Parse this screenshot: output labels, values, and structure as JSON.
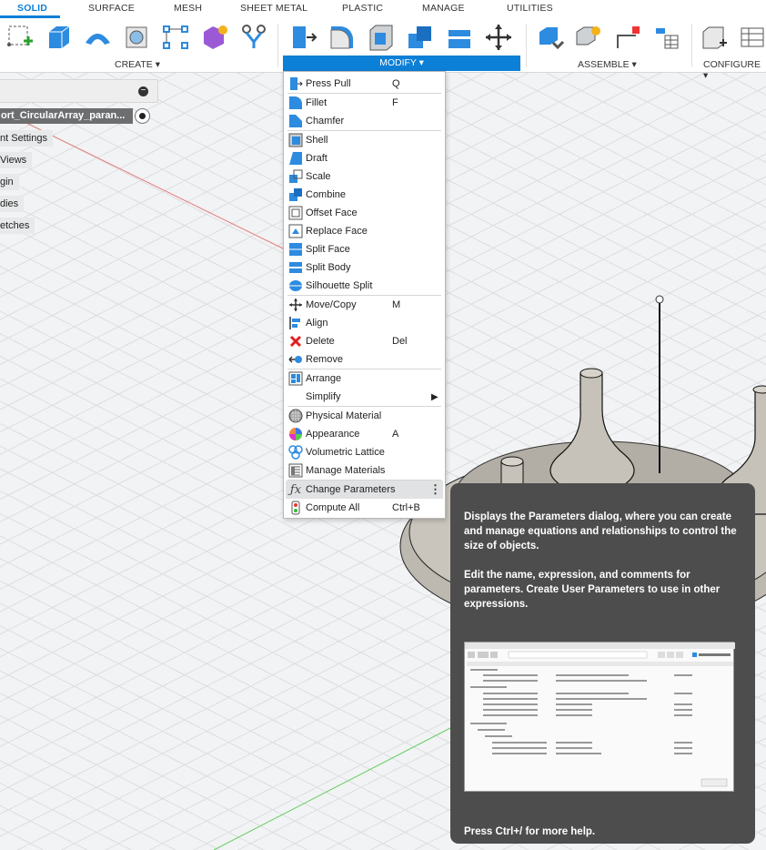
{
  "tabs": [
    "SOLID",
    "SURFACE",
    "MESH",
    "SHEET METAL",
    "PLASTIC",
    "MANAGE",
    "UTILITIES"
  ],
  "toolbar": {
    "create_label": "CREATE ▾",
    "modify_label": "MODIFY ▾",
    "assemble_label": "ASSEMBLE ▾",
    "configure_label": "CONFIGURE ▾"
  },
  "browser": {
    "minus": "−",
    "doc_name": "ort_CircularArray_paran...",
    "items": [
      "nt Settings",
      "Views",
      "gin",
      "dies",
      "etches"
    ]
  },
  "menu": {
    "items": [
      {
        "label": "Press Pull",
        "shortcut": "Q",
        "icon": "press-pull-icon"
      },
      {
        "label": "Fillet",
        "shortcut": "F",
        "icon": "fillet-icon"
      },
      {
        "label": "Chamfer",
        "shortcut": "",
        "icon": "chamfer-icon"
      },
      {
        "label": "Shell",
        "shortcut": "",
        "icon": "shell-icon"
      },
      {
        "label": "Draft",
        "shortcut": "",
        "icon": "draft-icon"
      },
      {
        "label": "Scale",
        "shortcut": "",
        "icon": "scale-icon"
      },
      {
        "label": "Combine",
        "shortcut": "",
        "icon": "combine-icon"
      },
      {
        "label": "Offset Face",
        "shortcut": "",
        "icon": "offset-face-icon"
      },
      {
        "label": "Replace Face",
        "shortcut": "",
        "icon": "replace-face-icon"
      },
      {
        "label": "Split Face",
        "shortcut": "",
        "icon": "split-face-icon"
      },
      {
        "label": "Split Body",
        "shortcut": "",
        "icon": "split-body-icon"
      },
      {
        "label": "Silhouette Split",
        "shortcut": "",
        "icon": "silhouette-split-icon"
      },
      {
        "label": "Move/Copy",
        "shortcut": "M",
        "icon": "move-copy-icon"
      },
      {
        "label": "Align",
        "shortcut": "",
        "icon": "align-icon"
      },
      {
        "label": "Delete",
        "shortcut": "Del",
        "icon": "delete-icon"
      },
      {
        "label": "Remove",
        "shortcut": "",
        "icon": "remove-icon"
      },
      {
        "label": "Arrange",
        "shortcut": "",
        "icon": "arrange-icon"
      },
      {
        "label": "Simplify",
        "shortcut": "",
        "icon": "simplify-icon"
      },
      {
        "label": "Physical Material",
        "shortcut": "",
        "icon": "physical-material-icon"
      },
      {
        "label": "Appearance",
        "shortcut": "A",
        "icon": "appearance-icon"
      },
      {
        "label": "Volumetric Lattice",
        "shortcut": "",
        "icon": "volumetric-lattice-icon"
      },
      {
        "label": "Manage Materials",
        "shortcut": "",
        "icon": "manage-materials-icon"
      },
      {
        "label": "Change Parameters",
        "shortcut": "",
        "icon": "fx-icon"
      },
      {
        "label": "Compute All",
        "shortcut": "Ctrl+B",
        "icon": "compute-all-icon"
      }
    ]
  },
  "tooltip": {
    "para1": "Displays the Parameters dialog, where you can create and manage equations and relationships to control the size of objects.",
    "para2": "Edit the name, expression, and comments for parameters. Create User Parameters to use in other expressions.",
    "footer": "Press Ctrl+/ for more help."
  },
  "colors": {
    "accent": "#0c7fd6",
    "tooltip_bg": "#4d4d4e",
    "doc_bar": "#6d6e70",
    "highlight": "#e1e2e3"
  }
}
